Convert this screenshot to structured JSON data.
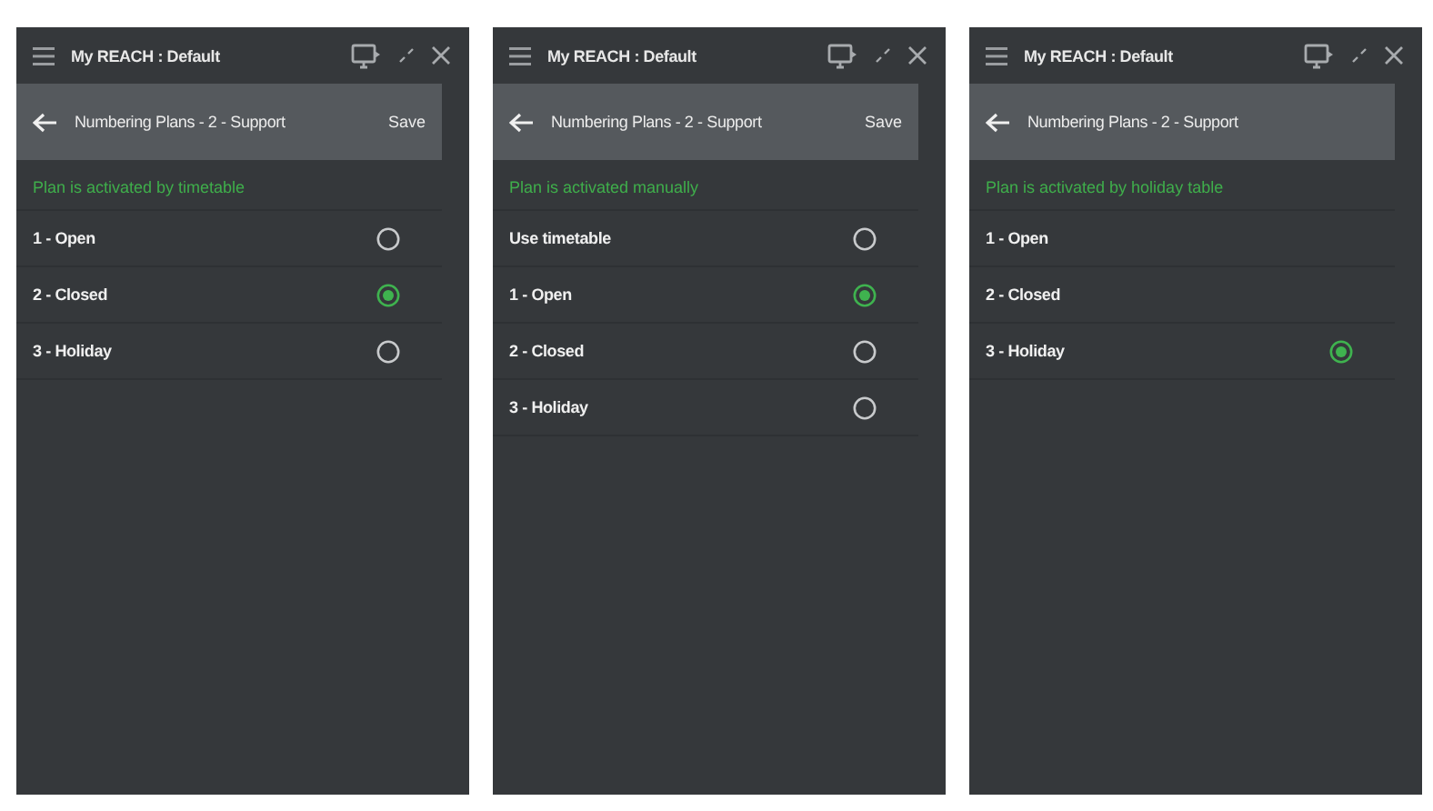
{
  "panels": [
    {
      "window": {
        "title": "My REACH : Default"
      },
      "header": {
        "title": "Numbering Plans - 2 - Support",
        "save": "Save"
      },
      "status": "Plan is activated by timetable",
      "options": [
        {
          "label": "1 - Open",
          "kind": "radio",
          "selected": false
        },
        {
          "label": "2 - Closed",
          "kind": "radio",
          "selected": true
        },
        {
          "label": "3 - Holiday",
          "kind": "radio",
          "selected": false
        }
      ]
    },
    {
      "window": {
        "title": "My REACH : Default"
      },
      "header": {
        "title": "Numbering Plans - 2 - Support",
        "save": "Save"
      },
      "status": "Plan is activated manually",
      "options": [
        {
          "label": "Use timetable",
          "kind": "radio",
          "selected": false
        },
        {
          "label": "1 - Open",
          "kind": "radio",
          "selected": true
        },
        {
          "label": "2 - Closed",
          "kind": "radio",
          "selected": false
        },
        {
          "label": "3 - Holiday",
          "kind": "radio",
          "selected": false
        }
      ]
    },
    {
      "window": {
        "title": "My REACH : Default"
      },
      "header": {
        "title": "Numbering Plans - 2 - Support"
      },
      "status": "Plan is activated by holiday table",
      "options": [
        {
          "label": "1 - Open",
          "kind": "plain",
          "selected": false
        },
        {
          "label": "2 - Closed",
          "kind": "plain",
          "selected": false
        },
        {
          "label": "3 - Holiday",
          "kind": "radio",
          "selected": true
        }
      ]
    }
  ]
}
